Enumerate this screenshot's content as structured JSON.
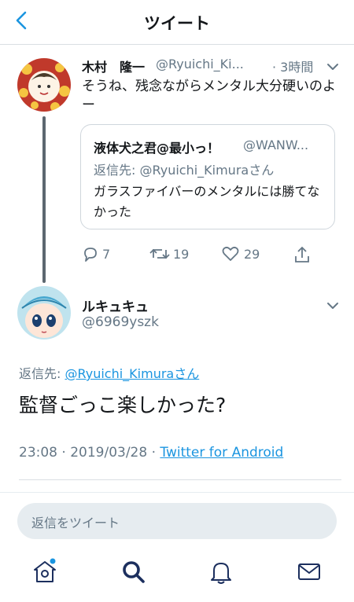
{
  "header": {
    "title": "ツイート"
  },
  "parent_tweet": {
    "author_name": "木村　隆一",
    "handle": "@Ryuichi_Ki...",
    "time": "· 3時間",
    "text": "そうね、残念ながらメンタル大分硬いのよー",
    "quote": {
      "author_name": "液体犬之君@最小っ！",
      "handle": "@WANW...",
      "reply_to": "返信先: @Ryuichi_Kimuraさん",
      "text": "ガラスファイバーのメンタルには勝てなかった"
    },
    "actions": {
      "replies": "7",
      "retweets": "19",
      "likes": "29"
    }
  },
  "main_tweet": {
    "author_name": "ルキュキュ",
    "handle": "@6969yszk",
    "reply_prefix": "返信先: ",
    "reply_to": "@Ryuichi_Kimuraさん",
    "text": "監督ごっこ楽しかった?",
    "timestamp": "23:08 · 2019/03/28 · ",
    "source": "Twitter for Android"
  },
  "reply_box": {
    "placeholder": "返信をツイート"
  },
  "colors": {
    "accent": "#1b95e0",
    "secondary_text": "#657786",
    "icon_navy": "#1c2f5e"
  },
  "tabs": [
    "home-icon",
    "search-icon",
    "notifications-icon",
    "messages-icon"
  ]
}
